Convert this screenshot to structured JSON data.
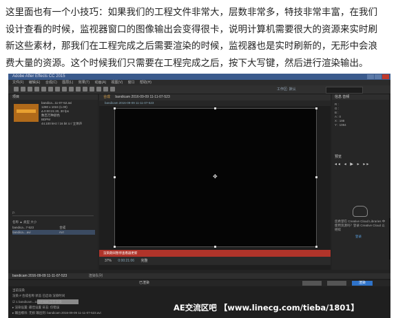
{
  "article": {
    "lines": [
      "这里面也有一个小技巧：如果我们的工程文件非常大，层数非常多，特技非常丰富，在我们",
      "设计查看的时候，监视器窗口的图像输出会变得很卡，说明计算机需要很大的资源来实时刷",
      "新这些素材，那我们在工程完成之后需要渲染的时候，监视器也是实时刷新的，无形中会浪",
      "费大量的资源。这个时候我们只需要在工程完成之后，按下大写键，然后进行渲染输出。"
    ]
  },
  "screenshot": {
    "title": "Adobe After Effects CC 2015",
    "menu": [
      "文件(F)",
      "编辑(E)",
      "合成(C)",
      "图层(L)",
      "效果(T)",
      "动画(A)",
      "视图(V)",
      "窗口",
      "帮助(H)"
    ],
    "workspace": "工作区: 默认",
    "project": {
      "tab": "项目",
      "file_name": "bandica...11-07-52.avi",
      "info": [
        "1280 x 1024 (1.00)",
        "Δ 0:00:21:20, 30 fps",
        "数百万种颜色",
        "BDPM",
        "44.100 kHz / 16 bit U / 立体声"
      ],
      "search_placeholder": "ρ.",
      "columns": "名称          ▲  类型    大小",
      "rows": [
        {
          "name": "bandica...7-523",
          "type": "合成"
        },
        {
          "name": "bandica....avi",
          "type": "AVI"
        }
      ]
    },
    "composition": {
      "tab": "合成",
      "comp_name": "bandicam 2016-09-09 11-11-07-523",
      "warning": "渲染期间暂停查看器更新",
      "zoom": "37%",
      "timecode": "0:00:21:06",
      "view": "完整"
    },
    "right_panel": {
      "tabs": "信息  音频",
      "info": [
        "R :",
        "G :",
        "B :",
        "A : 0",
        "X : 198",
        "Y : 1084"
      ],
      "preview_label": "预览",
      "controls": "◂◂  ◂  ▶  ▸  ▸▸",
      "cc_message": "您希望在 Creative Cloud Libraries 中使用资源吗？登录 Creative Cloud 以继续",
      "cc_link": "登录"
    },
    "timeline": {
      "active_tab": "bandicam 2016-09-09 11-11-07-523",
      "next_tab": "渲染队列",
      "render_label": "已渲染",
      "stop_label": "停止",
      "pause_label": "暂停",
      "render_button": "渲染",
      "rows": [
        "当前渲染",
        "渲染  #  合成名称          状态    已启动    渲染时间",
        "☑  1  bandicam...11-07-523   正在渲染",
        "▸ 渲染设置: 最佳设置        日志: 仅错误",
        "▸ 输出模块: 无损            输出到: bandicam 2016-09-09 11-11-07-523.avi"
      ]
    },
    "watermark": "AE交流区吧 【www.linecg.com/tieba/1801】"
  }
}
